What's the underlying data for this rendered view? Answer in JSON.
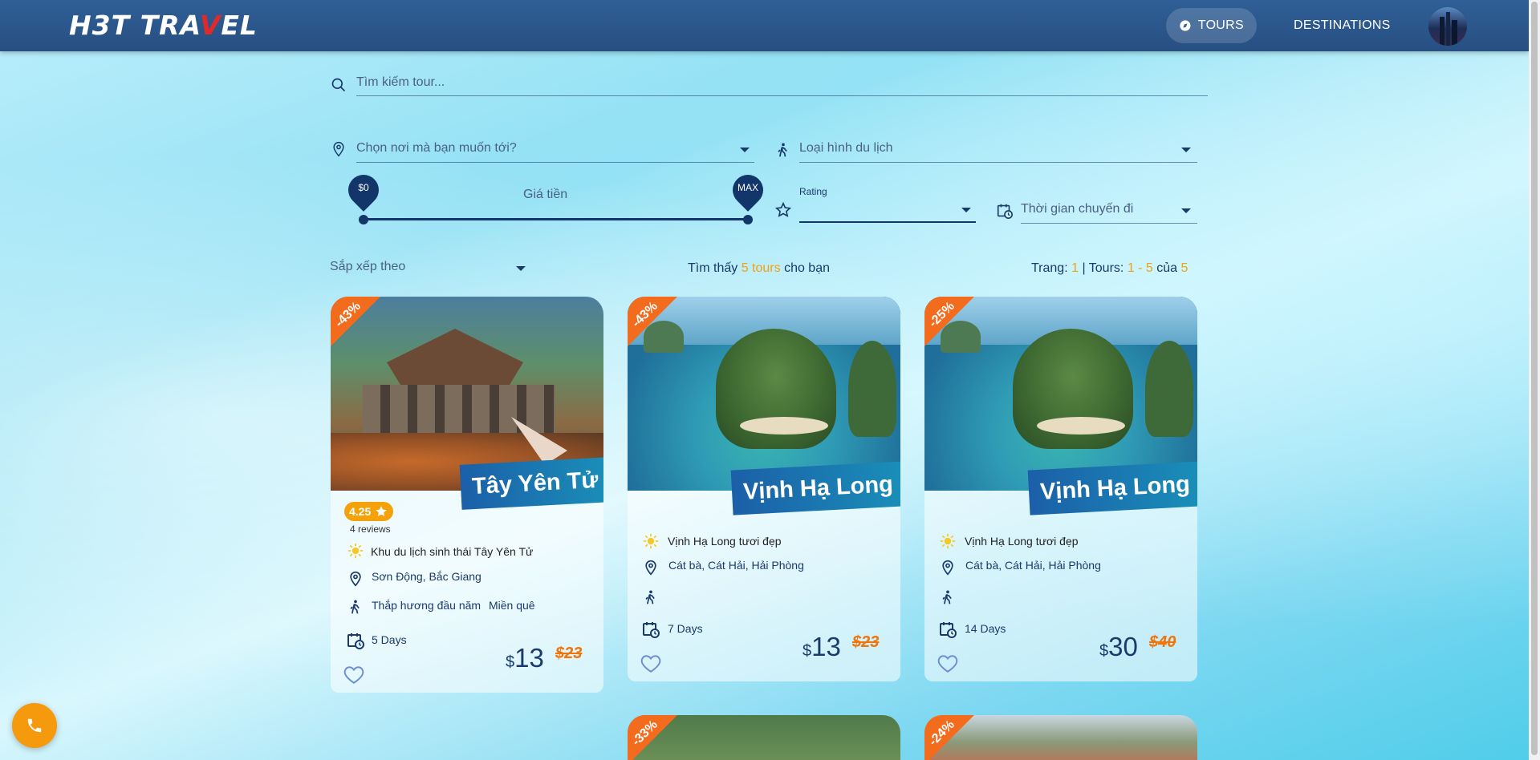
{
  "header": {
    "logo_a": "H3T TRA",
    "logo_v": "V",
    "logo_b": "EL",
    "nav_tours": "TOURS",
    "nav_destinations": "DESTINATIONS"
  },
  "search": {
    "placeholder": "Tìm kiếm tour..."
  },
  "filters": {
    "destination": "Chọn nơi mà bạn muốn tới?",
    "tour_type": "Loại hình du lịch",
    "price_label": "Giá tiền",
    "price_min": "$0",
    "price_max": "MAX",
    "rating_label": "Rating",
    "duration": "Thời gian chuyến đi"
  },
  "results": {
    "sort_label": "Sắp xếp theo",
    "found_prefix": "Tìm thấy",
    "found_count": "5 tours",
    "found_suffix": "cho bạn",
    "page_label": "Trang:",
    "page_value": "1",
    "tours_label": "| Tours:",
    "tours_range": "1 - 5",
    "of_label": "của",
    "total": "5"
  },
  "cards": [
    {
      "discount": "-43%",
      "title": "Tây Yên Tử",
      "rating": "4.25",
      "reviews": "4 reviews",
      "name": "Khu du lịch sinh thái Tây Yên Tử",
      "location": "Sơn Động, Bắc Giang",
      "type_1": "Thắp hương đầu năm",
      "type_2": "Miền quê",
      "days": "5 Days",
      "currency": "$",
      "price": "13",
      "old_price": "$23"
    },
    {
      "discount": "-43%",
      "title": "Vịnh Hạ Long",
      "name": "Vịnh Hạ Long tươi đẹp",
      "location": "Cát bà, Cát Hải, Hải Phòng",
      "days": "7 Days",
      "currency": "$",
      "price": "13",
      "old_price": "$23"
    },
    {
      "discount": "-25%",
      "title": "Vịnh Hạ Long",
      "name": "Vịnh Hạ Long tươi đẹp",
      "location": "Cát bà, Cát Hải, Hải Phòng",
      "days": "14 Days",
      "currency": "$",
      "price": "30",
      "old_price": "$40"
    },
    {
      "discount": "-33%"
    },
    {
      "discount": "-24%"
    }
  ],
  "colors": {
    "header": "#2f5f96",
    "accent": "#f2a20c",
    "discount": "#f36b1c",
    "navy": "#12356a"
  }
}
